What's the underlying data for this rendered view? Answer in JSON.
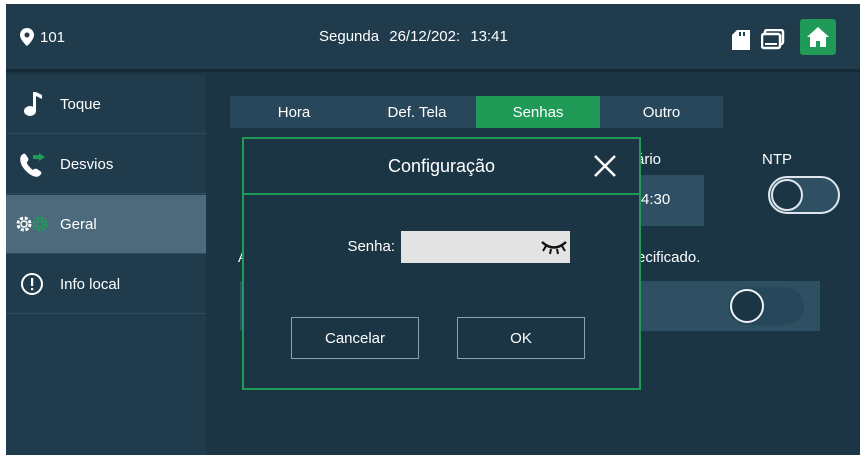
{
  "topbar": {
    "room_number": "101",
    "day": "Segunda",
    "date": "26/12/202:",
    "time": "13:41"
  },
  "sidebar": {
    "items": [
      {
        "label": "Toque",
        "icon": "music-note-icon"
      },
      {
        "label": "Desvios",
        "icon": "call-forward-icon"
      },
      {
        "label": "Geral",
        "icon": "gears-icon",
        "active": true
      },
      {
        "label": "Info local",
        "icon": "info-icon"
      }
    ]
  },
  "tabs": [
    {
      "label": "Hora"
    },
    {
      "label": "Def. Tela"
    },
    {
      "label": "Senhas",
      "active": true
    },
    {
      "label": "Outro"
    }
  ],
  "background": {
    "partial_label_1": "ário",
    "partial_value_1": ")4:30",
    "ntp_label": "NTP",
    "partial_label_2": "ecificado.",
    "partial_letter": "A"
  },
  "modal": {
    "title": "Configuração",
    "password_label": "Senha:",
    "password_value": "",
    "cancel_label": "Cancelar",
    "ok_label": "OK"
  },
  "colors": {
    "accent_green": "#1f9b57",
    "background": "#1c3545",
    "panel": "#1f3b4c",
    "active_sidebar": "#4d6a7d"
  }
}
